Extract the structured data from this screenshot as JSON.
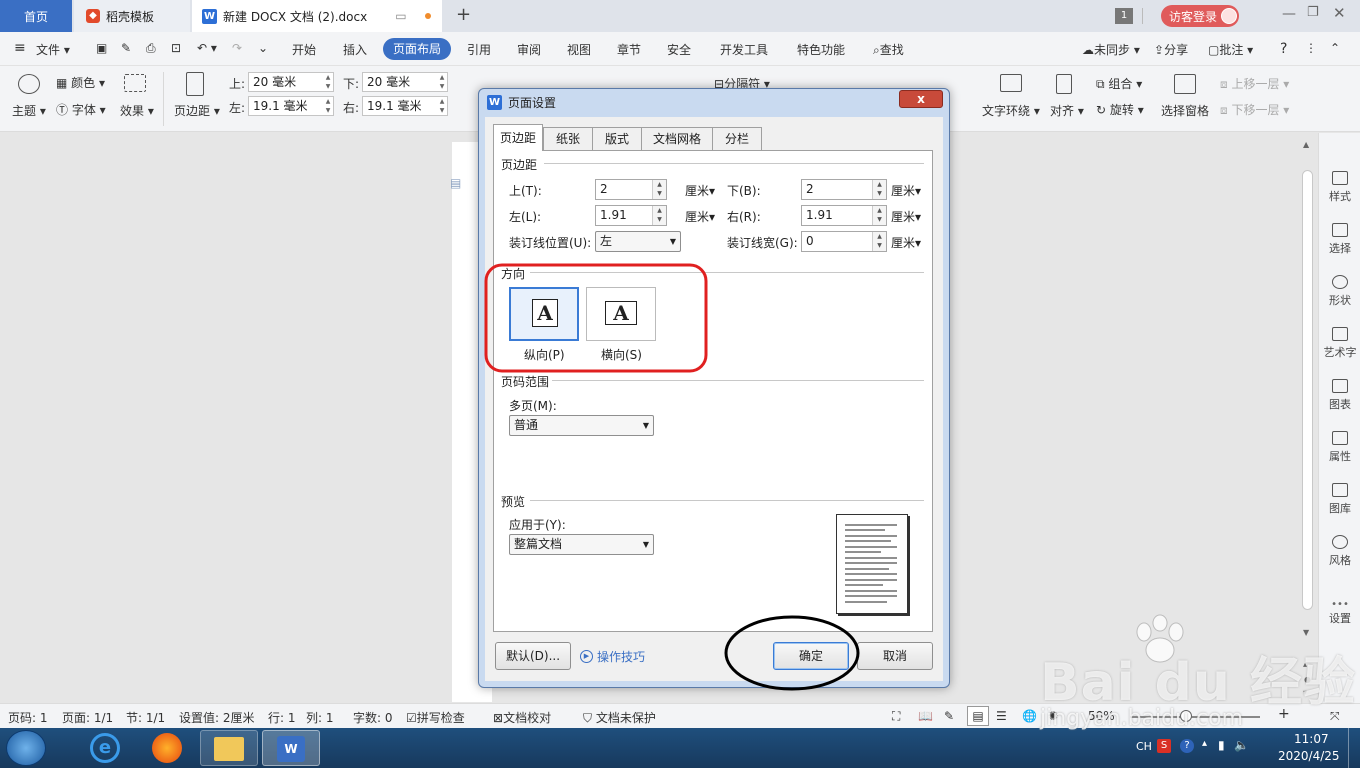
{
  "tabs": {
    "home": "首页",
    "template": "稻壳模板",
    "doc": "新建 DOCX 文档 (2).docx",
    "add": "+"
  },
  "titlebar": {
    "badge": "1",
    "login": "访客登录"
  },
  "menu": {
    "file": "文件",
    "items": [
      "开始",
      "插入",
      "页面布局",
      "引用",
      "审阅",
      "视图",
      "章节",
      "安全",
      "开发工具",
      "特色功能"
    ],
    "search": "查找",
    "sync": "未同步",
    "share": "分享",
    "comment": "批注",
    "help": "?"
  },
  "ribbon": {
    "color": "颜色",
    "theme": "主题",
    "font": "字体",
    "effect": "效果",
    "margin": "页边距",
    "top_label": "上:",
    "top_value": "20 毫米",
    "bottom_label": "下:",
    "bottom_value": "20 毫米",
    "left_label": "左:",
    "left_value": "19.1 毫米",
    "right_label": "右:",
    "right_value": "19.1 毫米",
    "separator": "分隔符",
    "text_wrap": "文字环绕",
    "align": "对齐",
    "group": "组合",
    "rotate": "旋转",
    "selection_pane": "选择窗格",
    "bring_forward": "上移一层",
    "send_backward": "下移一层"
  },
  "sidebar": [
    "样式",
    "选择",
    "形状",
    "艺术字",
    "图表",
    "属性",
    "图库",
    "风格",
    "设置"
  ],
  "status": {
    "page_num": "页码: 1",
    "pages": "页面: 1/1",
    "section": "节: 1/1",
    "setting": "设置值: 2厘米",
    "row": "行: 1",
    "col": "列: 1",
    "words": "字数: 0",
    "spell": "拼写检查",
    "compare": "文档校对",
    "protect": "文档未保护",
    "zoom": "50%"
  },
  "taskbar": {
    "ime": "CH",
    "time": "11:07",
    "date": "2020/4/25"
  },
  "dialog": {
    "title": "页面设置",
    "close": "x",
    "tabs": [
      "页边距",
      "纸张",
      "版式",
      "文档网格",
      "分栏"
    ],
    "margins_header": "页边距",
    "top_label": "上(T):",
    "top_value": "2",
    "bottom_label": "下(B):",
    "bottom_value": "2",
    "left_label": "左(L):",
    "left_value": "1.91",
    "right_label": "右(R):",
    "right_value": "1.91",
    "gutter_pos_label": "装订线位置(U):",
    "gutter_pos_value": "左",
    "gutter_width_label": "装订线宽(G):",
    "gutter_width_value": "0",
    "unit": "厘米",
    "orientation_header": "方向",
    "portrait": "纵向(P)",
    "landscape": "横向(S)",
    "orientation_icon_glyph": "A",
    "page_range_header": "页码范围",
    "multi_pages_label": "多页(M):",
    "multi_pages_value": "普通",
    "preview_header": "预览",
    "apply_to_label": "应用于(Y):",
    "apply_to_value": "整篇文档",
    "default_btn": "默认(D)...",
    "tips_link": "操作技巧",
    "ok_btn": "确定",
    "cancel_btn": "取消"
  },
  "watermark": {
    "brand": "Bai du 经验",
    "url": "jingyan.baidu.com"
  },
  "colors": {
    "accent": "#3a6fc4",
    "annotation_red": "#e02020",
    "annotation_black": "#000000"
  }
}
